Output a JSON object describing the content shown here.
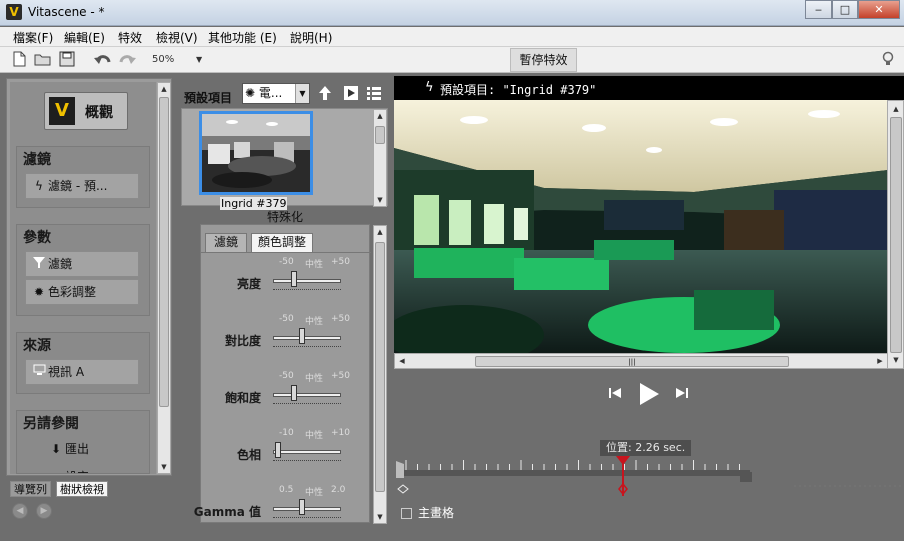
{
  "window": {
    "title": "Vitascene - *",
    "min": "‒",
    "max": "□",
    "close": "✕"
  },
  "menu": [
    "檔案(F)",
    "編輯(E)",
    "特效",
    "檢視(V)",
    "其他功能 (E)",
    "說明(H)"
  ],
  "toolbar": {
    "zoom": "50%",
    "pause_label": "暫停特效"
  },
  "left_panel": {
    "overview_label": "概觀",
    "sections": [
      {
        "title": "濾鏡",
        "buttons": [
          {
            "icon": "bolt-icon",
            "label": "濾鏡 - 預..."
          }
        ]
      },
      {
        "title": "參數",
        "buttons": [
          {
            "icon": "funnel-icon",
            "label": "濾鏡"
          },
          {
            "icon": "sun-icon",
            "label": "色彩調整"
          }
        ]
      },
      {
        "title": "來源",
        "buttons": [
          {
            "icon": "monitor-icon",
            "label": "視訊 A"
          }
        ]
      },
      {
        "title": "另請參閱",
        "buttons": [
          {
            "icon": "export-icon",
            "label": "匯出"
          },
          {
            "icon": "tools-icon",
            "label": "設定"
          }
        ]
      }
    ],
    "tabs": [
      "導覽列",
      "樹狀檢視"
    ]
  },
  "preset": {
    "label": "預設項目",
    "select_value": "電..."
  },
  "thumbnail": {
    "caption": "Ingrid #379"
  },
  "special_label": "特殊化",
  "adjust": {
    "tabs": [
      "濾鏡",
      "顏色調整"
    ],
    "active_tab": 1,
    "sliders": [
      {
        "label": "亮度",
        "min": "-50",
        "mid": "中性",
        "max": "+50",
        "value": 0.25
      },
      {
        "label": "對比度",
        "min": "-50",
        "mid": "中性",
        "max": "+50",
        "value": 0.38
      },
      {
        "label": "飽和度",
        "min": "-50",
        "mid": "中性",
        "max": "+50",
        "value": 0.25
      },
      {
        "label": "色相",
        "min": "-10",
        "mid": "中性",
        "max": "+10",
        "value": 0.0
      },
      {
        "label": "Gamma 值",
        "min": "0.5",
        "mid": "中性",
        "max": "2.0",
        "value": 0.38
      }
    ]
  },
  "viewer": {
    "preset_text": "預設項目:  \"Ingrid #379\""
  },
  "timeline": {
    "position_text": "位置: 2.26 sec.",
    "playhead_fraction": 0.65
  },
  "overlay_grid_label": "主畫格",
  "colors": {
    "accent_blue": "#3c8ee6",
    "playhead_red": "#c8141e"
  }
}
